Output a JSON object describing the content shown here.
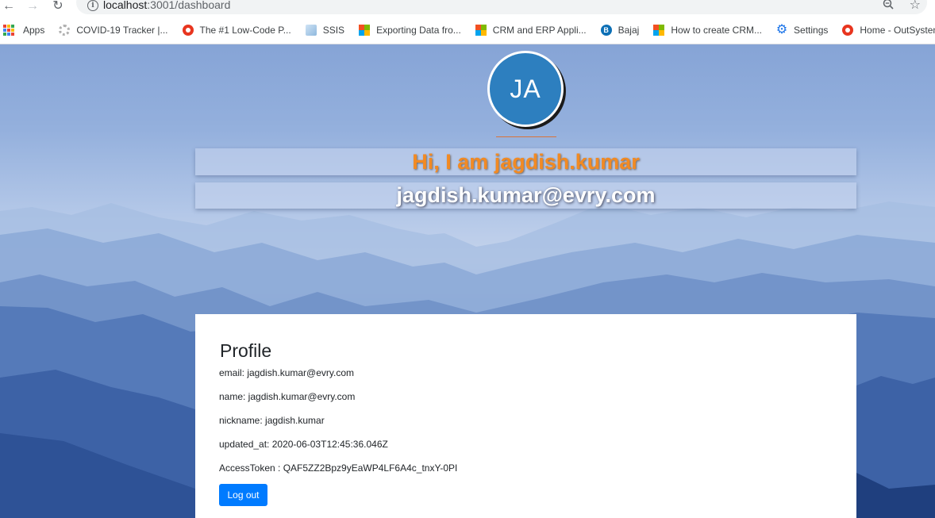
{
  "browser": {
    "url_host": "localhost",
    "url_path": ":3001/dashboard",
    "bookmarks": [
      {
        "label": "Apps",
        "icon": "apps-grid-icon"
      },
      {
        "label": "COVID-19 Tracker |...",
        "icon": "covid-icon"
      },
      {
        "label": "The #1 Low-Code P...",
        "icon": "outsystems-icon"
      },
      {
        "label": "SSIS",
        "icon": "ssis-icon"
      },
      {
        "label": "Exporting Data fro...",
        "icon": "microsoft-icon"
      },
      {
        "label": "CRM and ERP Appli...",
        "icon": "microsoft-icon"
      },
      {
        "label": "Bajaj",
        "icon": "bajaj-icon"
      },
      {
        "label": "How to create CRM...",
        "icon": "microsoft-icon"
      },
      {
        "label": "Settings",
        "icon": "gear-icon"
      },
      {
        "label": "Home - OutSystems",
        "icon": "outsystems-icon"
      }
    ]
  },
  "header": {
    "avatar_initials": "JA",
    "greeting": "Hi, I am jagdish.kumar",
    "email": "jagdish.kumar@evry.com"
  },
  "profile": {
    "title": "Profile",
    "email": "email: jagdish.kumar@evry.com",
    "name": "name: jagdish.kumar@evry.com",
    "nickname": "nickname: jagdish.kumar",
    "updated_at": "updated_at: 2020-06-03T12:45:36.046Z",
    "access_token": "AccessToken : QAF5ZZ2Bpz9yEaWP4LF6A4c_tnxY-0PI",
    "logout_label": "Log out"
  },
  "colors": {
    "avatar_bg": "#2d7fbf",
    "greeting": "#f28a23",
    "button": "#007bff"
  }
}
